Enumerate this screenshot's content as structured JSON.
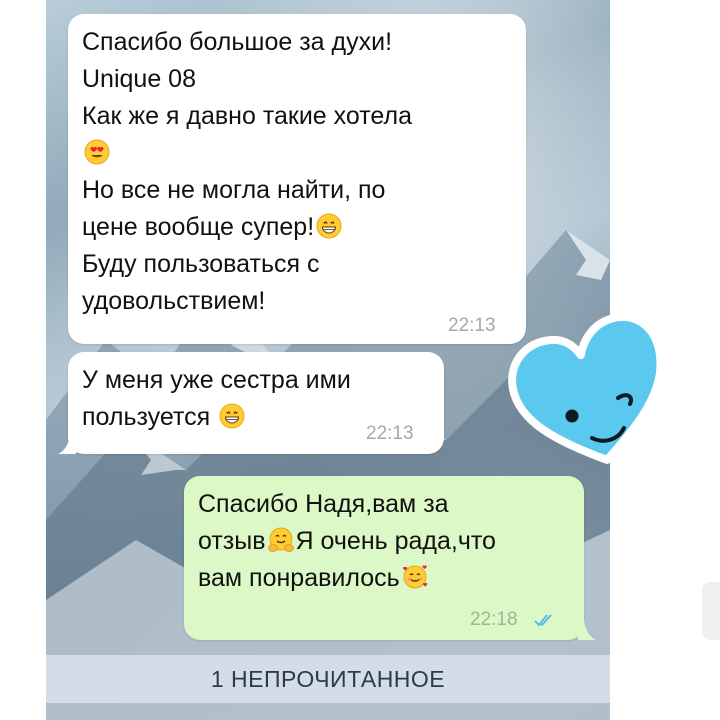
{
  "messages": [
    {
      "direction": "incoming",
      "lines": {
        "l1": "Спасибо большое за духи!",
        "l2": "Unique 08",
        "l3": "Как же я давно такие хотела",
        "l4": "Но все не могла найти, по",
        "l5": "цене вообще супер!",
        "l6": "Буду пользоваться с",
        "l7": "удовольствием!"
      },
      "emojis": [
        "heart-eyes-emoji",
        "grinning-emoji"
      ],
      "time": "22:13"
    },
    {
      "direction": "incoming",
      "lines": {
        "l1": "У меня уже сестра ими",
        "l2": "пользуется"
      },
      "emojis": [
        "grinning-emoji"
      ],
      "time": "22:13"
    },
    {
      "direction": "outgoing",
      "lines": {
        "l1": "Спасибо Надя,вам за",
        "l2a": "отзыв",
        "l2b": "Я очень рада,что",
        "l3": "вам понравилось"
      },
      "emojis": [
        "hugging-emoji",
        "smiling-hearts-emoji"
      ],
      "time": "22:18",
      "status": "read-double-check"
    }
  ],
  "unread_banner": "1 НЕПРОЧИТАННОЕ",
  "sticker": "blue-heart-wink-sticker",
  "colors": {
    "incoming_bubble": "#ffffff",
    "outgoing_bubble": "#dcf8c6",
    "read_ticks": "#4fb6ec",
    "sticker_heart": "#5bc8ef"
  }
}
